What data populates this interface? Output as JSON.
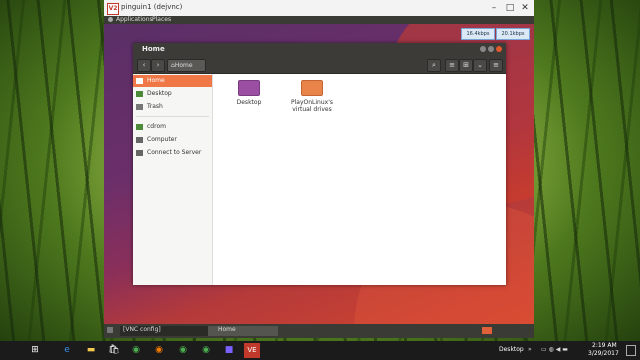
{
  "vnc": {
    "title": "pinguin1 (dejvnc)",
    "menu": [
      "Applications",
      "Places"
    ]
  },
  "speeds": [
    "16.4kbps",
    "20.1kbps"
  ],
  "file_manager": {
    "title": "Home",
    "path_button": "Home",
    "sidebar": [
      {
        "label": "Home",
        "icon": "home-icon",
        "active": true
      },
      {
        "label": "Desktop",
        "icon": "desktop-icon",
        "active": false
      },
      {
        "label": "Trash",
        "icon": "trash-icon",
        "active": false
      },
      {
        "label": "cdrom",
        "icon": "drive-icon",
        "active": false
      },
      {
        "label": "Computer",
        "icon": "computer-icon",
        "active": false
      },
      {
        "label": "Connect to Server",
        "icon": "server-icon",
        "active": false
      }
    ],
    "files": [
      {
        "label": "Desktop",
        "icon": "folder-icon",
        "color": "#9b4fa3"
      },
      {
        "label": "PlayOnLinux's virtual drives",
        "icon": "folder-icon",
        "color": "#e8834a"
      }
    ]
  },
  "bottom_panel": {
    "item1": "[VNC config]",
    "item2": "Home"
  },
  "taskbar": {
    "desktop_label": "Desktop",
    "time": "2:19 AM",
    "date": "3/29/2017"
  },
  "colors": {
    "accent": "#f07746",
    "panel": "#3c3b37"
  }
}
